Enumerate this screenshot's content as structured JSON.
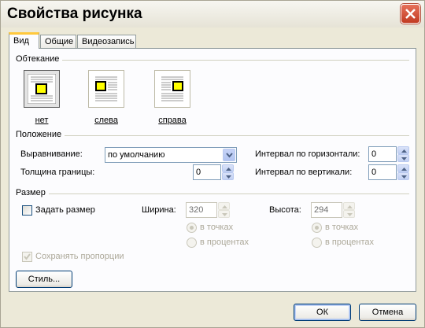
{
  "window": {
    "title": "Свойства рисунка"
  },
  "tabs": [
    {
      "label": "Вид"
    },
    {
      "label": "Общие"
    },
    {
      "label": "Видеозапись"
    }
  ],
  "wrapping": {
    "group_label": "Обтекание",
    "options": [
      {
        "label": "нет",
        "selected": true
      },
      {
        "label": "слева",
        "selected": false
      },
      {
        "label": "справа",
        "selected": false
      }
    ]
  },
  "position": {
    "group_label": "Положение",
    "alignment_label": "Выравнивание:",
    "alignment_value": "по умолчанию",
    "border_label": "Толщина границы:",
    "border_value": "0",
    "hspace_label": "Интервал по горизонтали:",
    "hspace_value": "0",
    "vspace_label": "Интервал по вертикали:",
    "vspace_value": "0"
  },
  "size": {
    "group_label": "Размер",
    "set_size_label": "Задать размер",
    "set_size_checked": false,
    "width_label": "Ширина:",
    "width_value": "320",
    "height_label": "Высота:",
    "height_value": "294",
    "in_points_label": "в точках",
    "in_percent_label": "в процентах",
    "keep_ratio_label": "Сохранять пропорции",
    "keep_ratio_checked": true
  },
  "style_button": "Стиль...",
  "ok_button": "ОК",
  "cancel_button": "Отмена",
  "colors": {
    "accent_yellow": "#ffff00",
    "tab_highlight": "#ffc83c",
    "close_red": "#c23b22"
  }
}
